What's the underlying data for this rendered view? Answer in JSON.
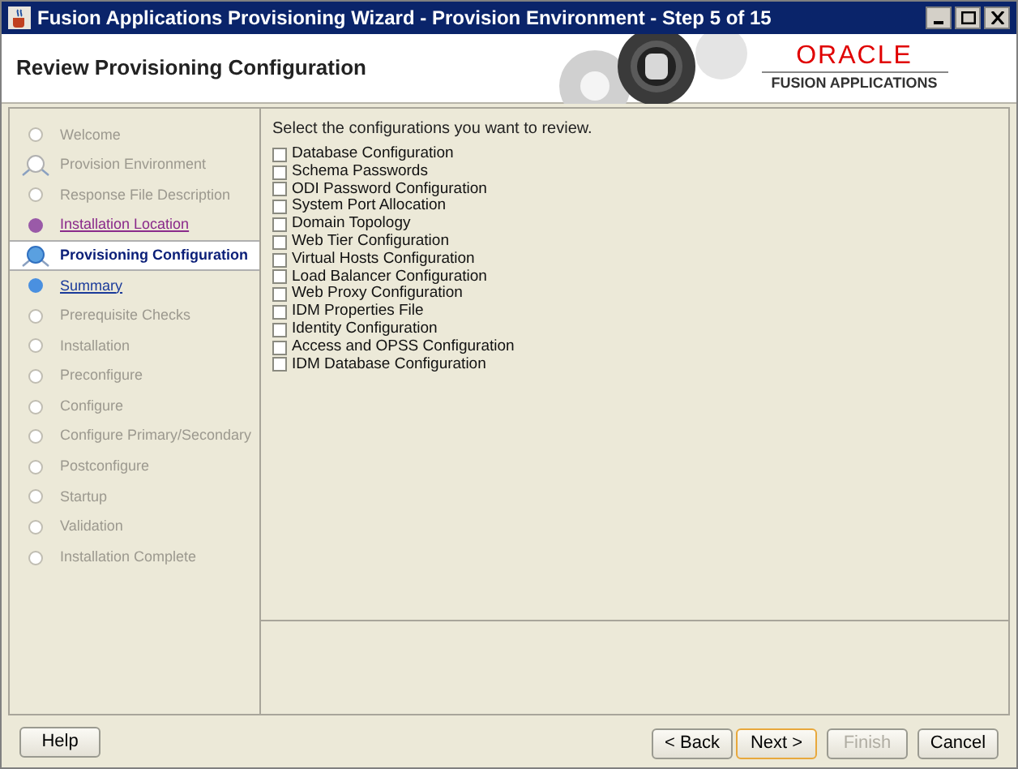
{
  "window": {
    "title": "Fusion Applications Provisioning Wizard - Provision Environment - Step 5 of 15"
  },
  "header": {
    "title": "Review Provisioning Configuration",
    "logo": "ORACLE",
    "logo_subtitle": "FUSION APPLICATIONS"
  },
  "steps": [
    {
      "label": "Welcome",
      "kind": "step",
      "disabled": true,
      "visited": false,
      "selected": false
    },
    {
      "label": "Provision Environment",
      "kind": "group",
      "disabled": true,
      "visited": false,
      "selected": false
    },
    {
      "label": "Response File Description",
      "kind": "step",
      "disabled": true,
      "visited": false,
      "selected": false
    },
    {
      "label": "Installation Location",
      "kind": "step",
      "disabled": false,
      "visited": true,
      "selected": false
    },
    {
      "label": "Provisioning Configuration",
      "kind": "step",
      "disabled": false,
      "visited": false,
      "selected": true
    },
    {
      "label": "Summary",
      "kind": "step",
      "disabled": false,
      "visited": false,
      "selected": false
    },
    {
      "label": "Prerequisite Checks",
      "kind": "step",
      "disabled": true,
      "visited": false,
      "selected": false
    },
    {
      "label": "Installation",
      "kind": "step",
      "disabled": true,
      "visited": false,
      "selected": false
    },
    {
      "label": "Preconfigure",
      "kind": "step",
      "disabled": true,
      "visited": false,
      "selected": false
    },
    {
      "label": "Configure",
      "kind": "step",
      "disabled": true,
      "visited": false,
      "selected": false
    },
    {
      "label": "Configure Primary/Secondary",
      "kind": "step",
      "disabled": true,
      "visited": false,
      "selected": false
    },
    {
      "label": "Postconfigure",
      "kind": "step",
      "disabled": true,
      "visited": false,
      "selected": false
    },
    {
      "label": "Startup",
      "kind": "step",
      "disabled": true,
      "visited": false,
      "selected": false
    },
    {
      "label": "Validation",
      "kind": "step",
      "disabled": true,
      "visited": false,
      "selected": false
    },
    {
      "label": "Installation Complete",
      "kind": "step",
      "disabled": true,
      "visited": false,
      "selected": false
    }
  ],
  "instruction": "Select the configurations you want to review.",
  "options": [
    {
      "label": "Database Configuration",
      "checked": false
    },
    {
      "label": "Schema Passwords",
      "checked": false
    },
    {
      "label": "ODI Password Configuration",
      "checked": false
    },
    {
      "label": "System Port Allocation",
      "checked": false
    },
    {
      "label": "Domain Topology",
      "checked": false
    },
    {
      "label": "Web Tier Configuration",
      "checked": false
    },
    {
      "label": "Virtual Hosts Configuration",
      "checked": false
    },
    {
      "label": "Load Balancer Configuration",
      "checked": false
    },
    {
      "label": "Web Proxy Configuration",
      "checked": false
    },
    {
      "label": "IDM Properties File",
      "checked": false
    },
    {
      "label": "Identity Configuration",
      "checked": false
    },
    {
      "label": "Access and OPSS Configuration",
      "checked": false
    },
    {
      "label": "IDM Database Configuration",
      "checked": false
    }
  ],
  "buttons_left": [
    {
      "label": "Help",
      "disabled": false,
      "selected": false
    }
  ],
  "buttons_right": [
    {
      "label": "< Back",
      "disabled": false,
      "selected": false
    },
    {
      "label": "Next >",
      "disabled": false,
      "selected": true
    },
    {
      "label": "Finish",
      "disabled": true,
      "selected": false
    },
    {
      "label": "Cancel",
      "disabled": false,
      "selected": false
    }
  ]
}
